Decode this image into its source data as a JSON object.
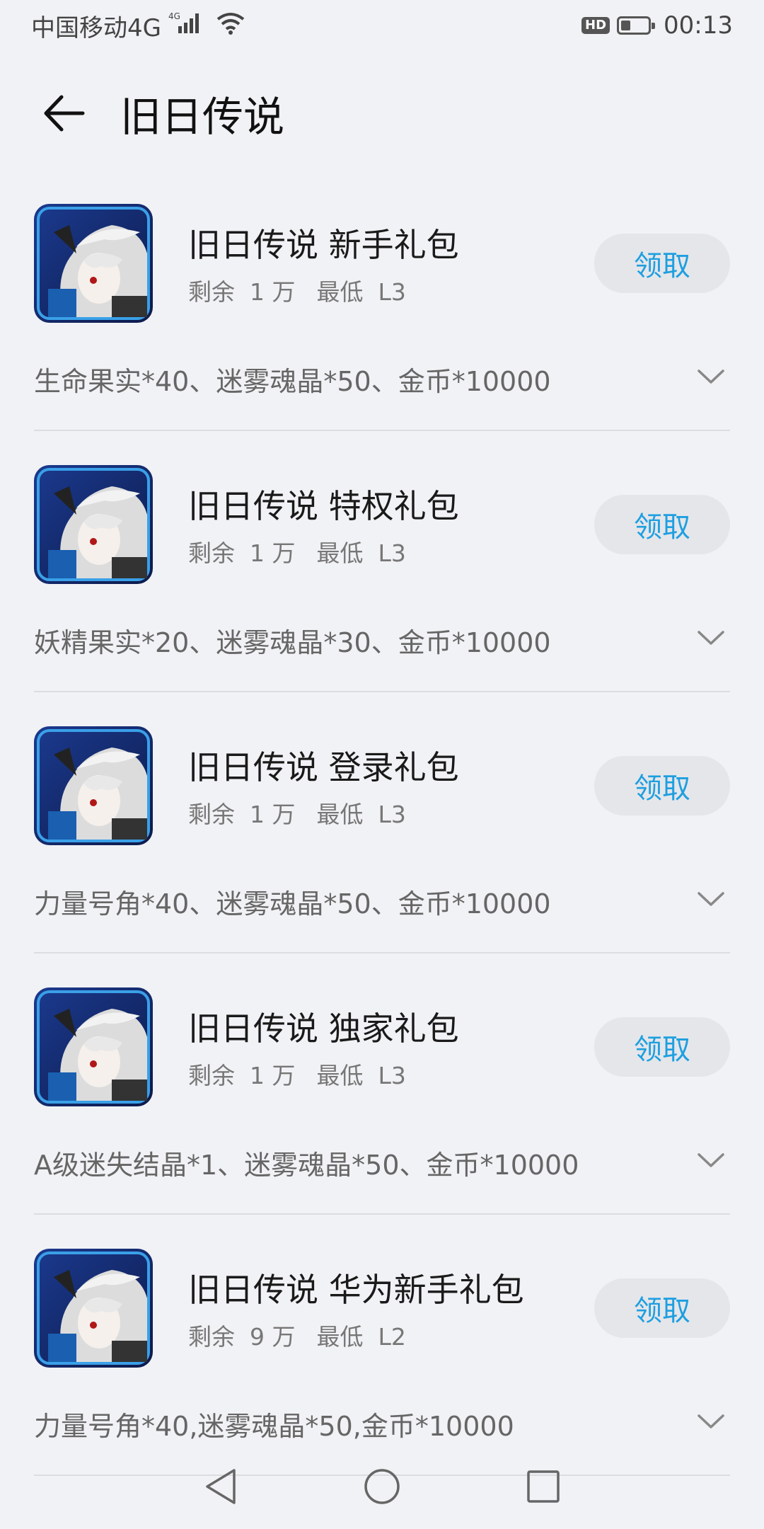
{
  "status_bar": {
    "carrier": "中国移动4G",
    "network_badge": "4G",
    "hd_label": "HD",
    "time": "00:13",
    "battery_level": 0.35
  },
  "header": {
    "title": "旧日传说"
  },
  "gifts": [
    {
      "name": "旧日传说 新手礼包",
      "remaining_label": "剩余",
      "remaining": "1 万",
      "min_label": "最低",
      "min_level": "L3",
      "button": "领取",
      "contents": "生命果实*40、迷雾魂晶*50、金币*10000"
    },
    {
      "name": "旧日传说 特权礼包",
      "remaining_label": "剩余",
      "remaining": "1 万",
      "min_label": "最低",
      "min_level": "L3",
      "button": "领取",
      "contents": "妖精果实*20、迷雾魂晶*30、金币*10000"
    },
    {
      "name": "旧日传说 登录礼包",
      "remaining_label": "剩余",
      "remaining": "1 万",
      "min_label": "最低",
      "min_level": "L3",
      "button": "领取",
      "contents": "力量号角*40、迷雾魂晶*50、金币*10000"
    },
    {
      "name": "旧日传说 独家礼包",
      "remaining_label": "剩余",
      "remaining": "1 万",
      "min_label": "最低",
      "min_level": "L3",
      "button": "领取",
      "contents": "A级迷失结晶*1、迷雾魂晶*50、金币*10000"
    },
    {
      "name": "旧日传说 华为新手礼包",
      "remaining_label": "剩余",
      "remaining": "9 万",
      "min_label": "最低",
      "min_level": "L2",
      "button": "领取",
      "contents": "力量号角*40,迷雾魂晶*50,金币*10000"
    }
  ],
  "colors": {
    "background": "#f1f2f5",
    "accent": "#1e9fe0",
    "button_bg": "#e5e6ea"
  },
  "icons": {
    "back": "arrow-left-icon",
    "expand": "chevron-down-icon",
    "nav_back": "triangle-back-icon",
    "nav_home": "circle-home-icon",
    "nav_recents": "square-recents-icon"
  }
}
